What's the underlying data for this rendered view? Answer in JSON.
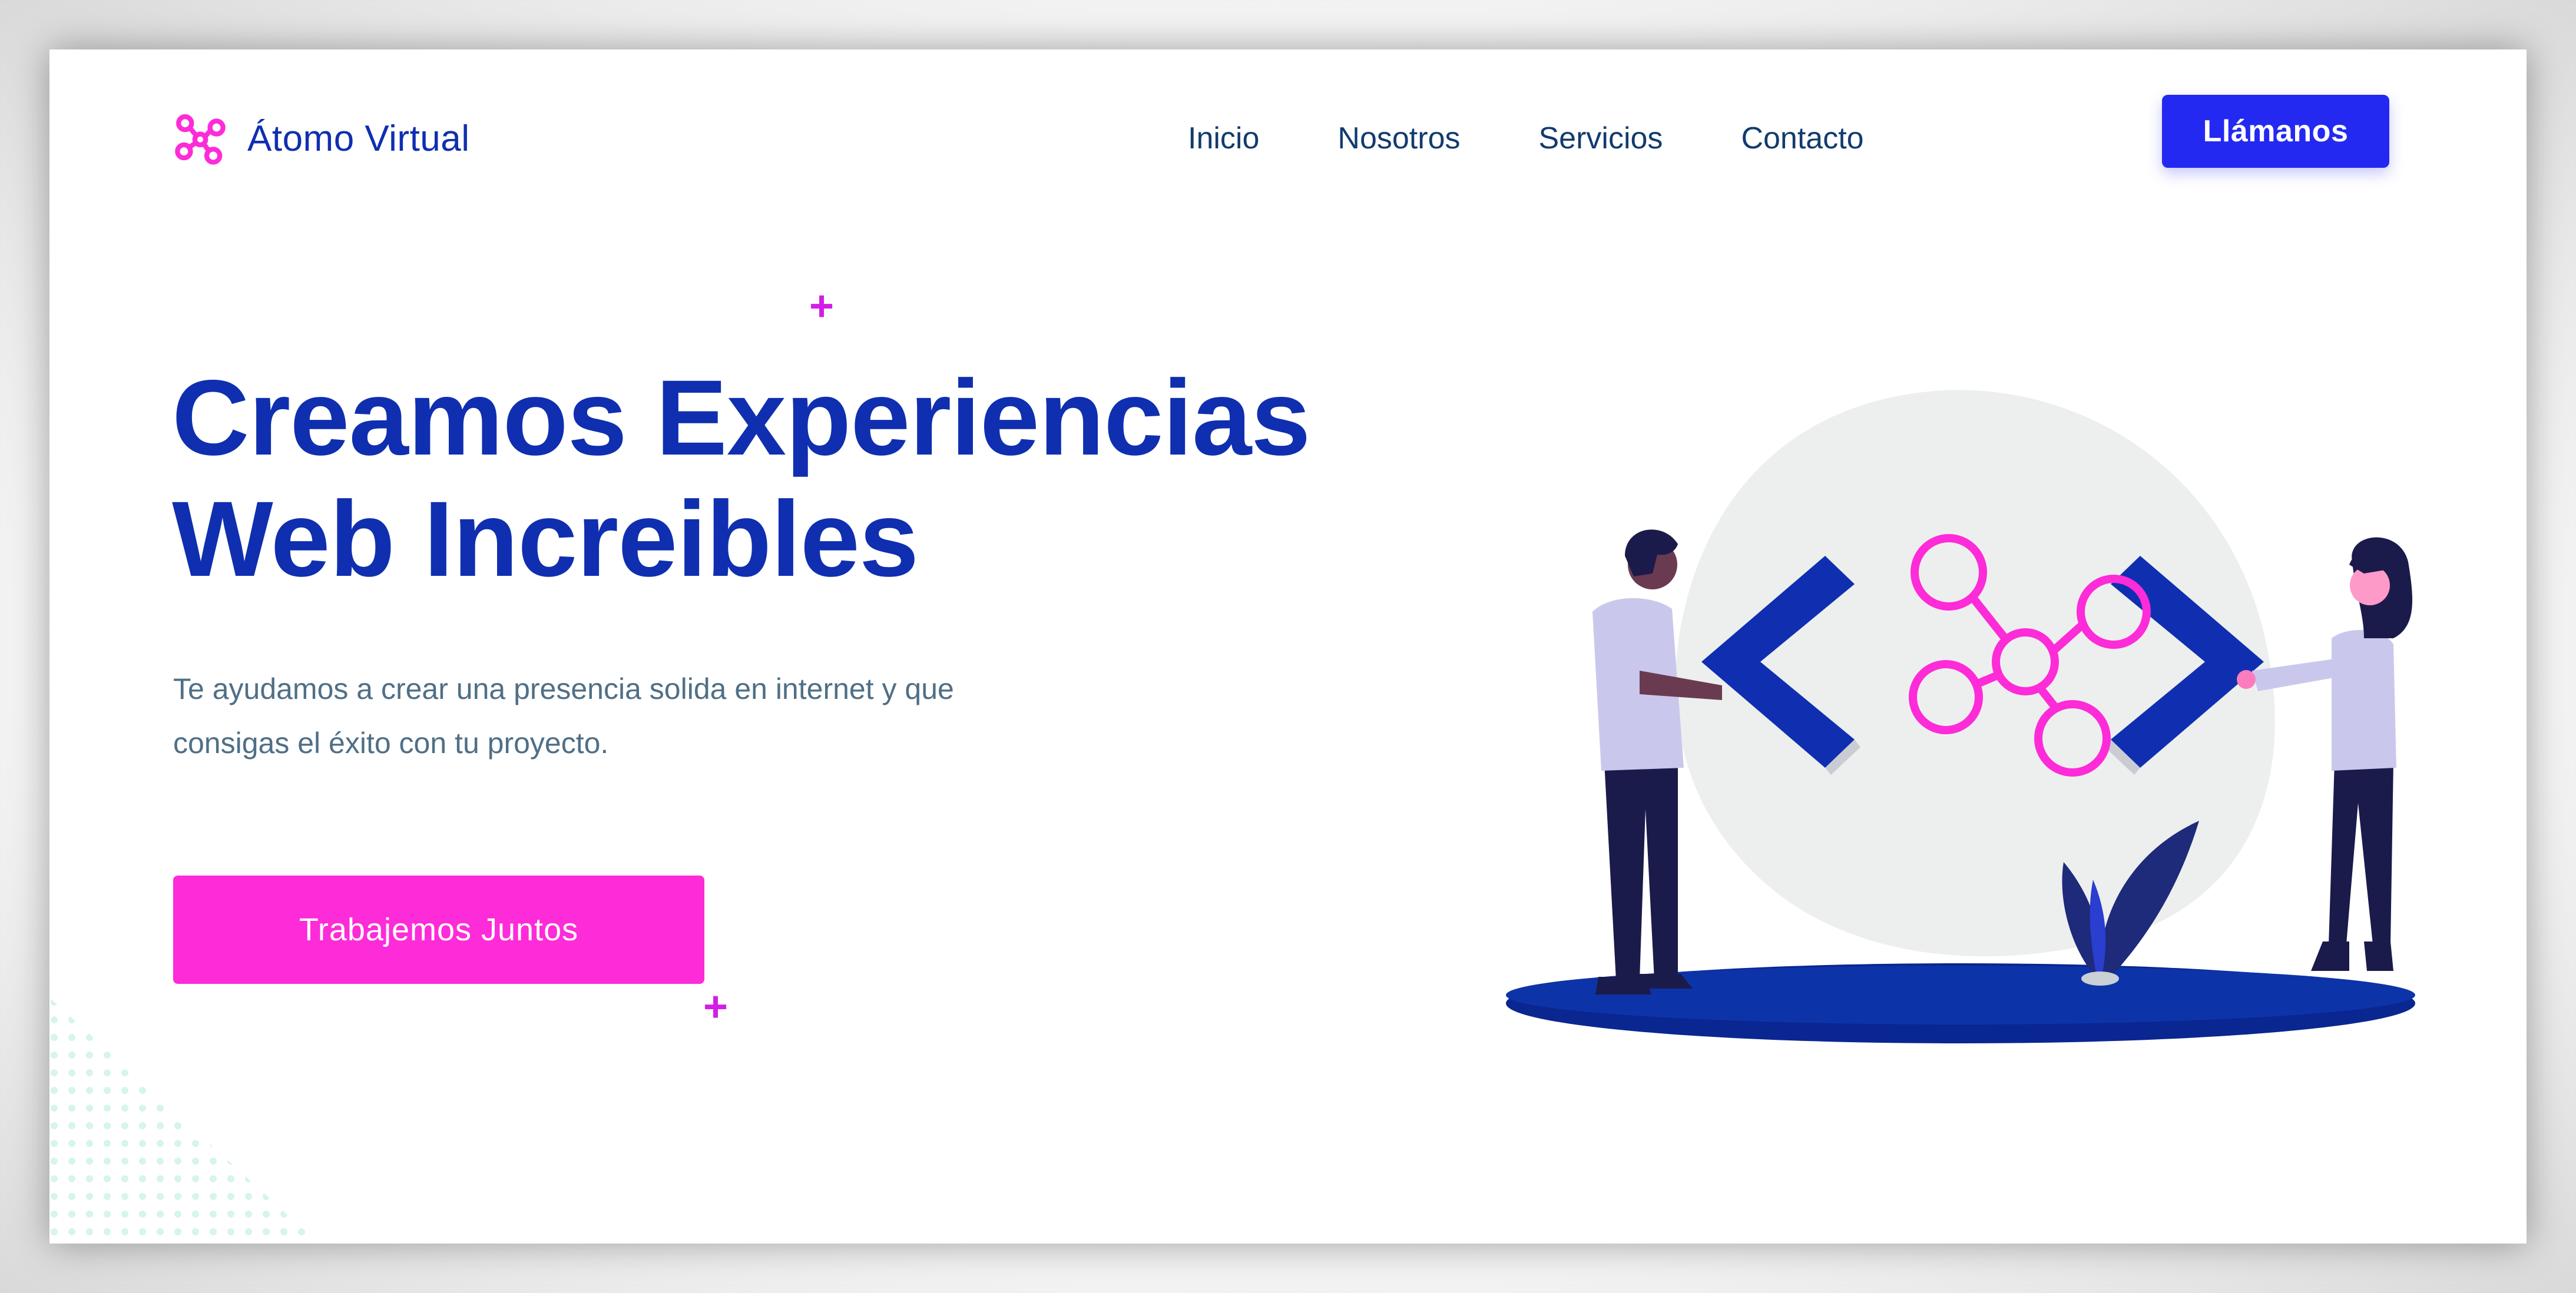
{
  "brand": {
    "name": "Átomo Virtual",
    "logo_icon": "molecule-icon",
    "color": "#0f2fb0",
    "logo_color": "#fd2bd8"
  },
  "nav": {
    "items": [
      {
        "label": "Inicio"
      },
      {
        "label": "Nosotros"
      },
      {
        "label": "Servicios"
      },
      {
        "label": "Contacto"
      }
    ],
    "call_button": "Llámanos"
  },
  "hero": {
    "title_line1": "Creamos Experiencias",
    "title_line2": "Web Increibles",
    "subtitle_line1": "Te ayudamos a crear una presencia solida en internet y que",
    "subtitle_line2": "consigas el éxito con tu proyecto.",
    "cta_label": "Trabajemos Juntos",
    "decor_plus": "+"
  },
  "colors": {
    "primary": "#0f2fb0",
    "accent_blue": "#2429f2",
    "accent_pink": "#fd2bd8",
    "text_muted": "#4f6f86",
    "blob": "#edefef"
  },
  "illustration": {
    "icons": [
      "code-bracket-left-icon",
      "molecule-network-icon",
      "code-bracket-right-icon",
      "plant-icon"
    ]
  }
}
